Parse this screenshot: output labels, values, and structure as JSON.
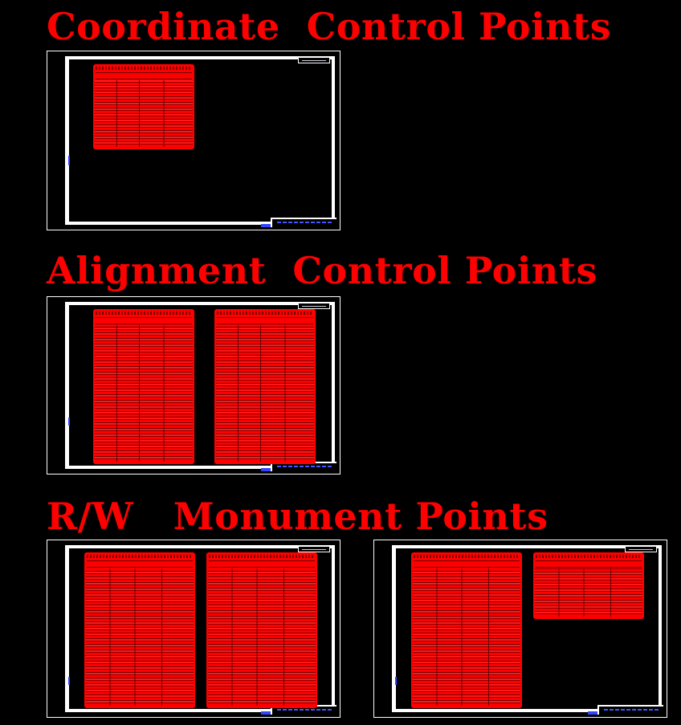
{
  "sections": [
    {
      "title": "Coordinate  Control Points",
      "sheet_count": 1,
      "tables_per_sheet": [
        1
      ]
    },
    {
      "title": "Alignment  Control Points",
      "sheet_count": 1,
      "tables_per_sheet": [
        2
      ]
    },
    {
      "title": "R/W   Monument Points",
      "sheet_count": 2,
      "tables_per_sheet": [
        2,
        2
      ]
    }
  ],
  "colors": {
    "background": "#000000",
    "heading": "#ff0000",
    "table_fill": "#ff0000",
    "sheet_border": "#ffffff",
    "accent": "#3344ff"
  }
}
